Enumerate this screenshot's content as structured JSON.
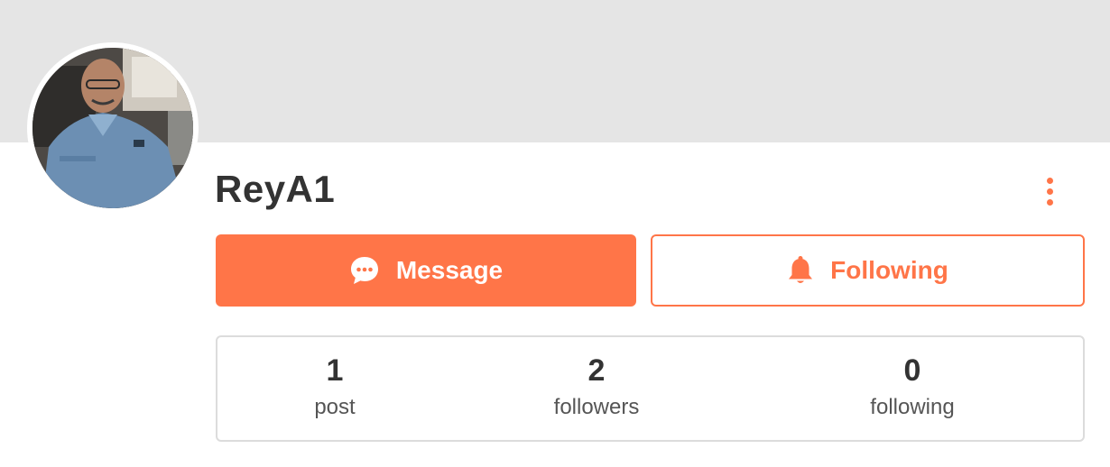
{
  "colors": {
    "accent": "#ff7548",
    "cover": "#e5e5e5",
    "border": "#dcdcdc"
  },
  "profile": {
    "username": "ReyA1",
    "avatar_icon": "profile-photo"
  },
  "actions": {
    "message_label": "Message",
    "message_icon": "chat-bubble-icon",
    "following_label": "Following",
    "following_icon": "bell-icon",
    "more_icon": "vertical-dots-icon"
  },
  "stats": [
    {
      "value": "1",
      "label": "post"
    },
    {
      "value": "2",
      "label": "followers"
    },
    {
      "value": "0",
      "label": "following"
    }
  ]
}
